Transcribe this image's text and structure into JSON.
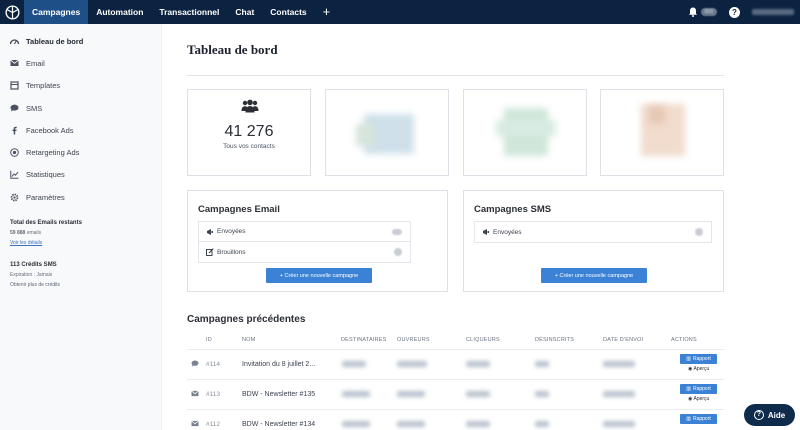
{
  "topbar": {
    "nav": [
      {
        "label": "Campagnes",
        "active": true
      },
      {
        "label": "Automation"
      },
      {
        "label": "Transactionnel"
      },
      {
        "label": "Chat"
      },
      {
        "label": "Contacts"
      }
    ],
    "plus": "+",
    "help": "?"
  },
  "sidebar": {
    "items": [
      {
        "label": "Tableau de bord",
        "icon": "dashboard-icon",
        "active": true
      },
      {
        "label": "Email",
        "icon": "envelope-icon"
      },
      {
        "label": "Templates",
        "icon": "template-icon"
      },
      {
        "label": "SMS",
        "icon": "sms-icon"
      },
      {
        "label": "Facebook Ads",
        "icon": "facebook-icon"
      },
      {
        "label": "Retargeting Ads",
        "icon": "target-icon"
      },
      {
        "label": "Statistiques",
        "icon": "chart-icon"
      },
      {
        "label": "Paramètres",
        "icon": "gear-icon"
      }
    ],
    "emails": {
      "title": "Total des Emails restants",
      "value": "59 888",
      "unit": "emails",
      "link": "Voir les détails"
    },
    "sms": {
      "title": "113 Crédits SMS",
      "expiration": "Expiration : Jamais",
      "link": "Obtenir plus de crédits"
    }
  },
  "main": {
    "title": "Tableau de bord",
    "contacts": {
      "value": "41 276",
      "label": "Tous vos contacts"
    },
    "email_campaigns": {
      "title": "Campagnes Email",
      "rows": [
        "Envoyées",
        "Brouillons"
      ],
      "button": "+ Créer une nouvelle campagne"
    },
    "sms_campaigns": {
      "title": "Campagnes SMS",
      "rows": [
        "Envoyées"
      ],
      "button": "+ Créer une nouvelle campagne"
    },
    "previous": {
      "title": "Campagnes précédentes",
      "columns": [
        "ID",
        "NOM",
        "DESTINATAIRES",
        "OUVREURS",
        "CLIQUEURS",
        "DÉSINSCRITS",
        "DATE D'ENVOI",
        "ACTIONS"
      ],
      "rows": [
        {
          "icon": "sms-icon",
          "id": "#114",
          "name": "Invitation du 8 juillet 2..."
        },
        {
          "icon": "envelope-icon",
          "id": "#113",
          "name": "BDW - Newsletter #135"
        },
        {
          "icon": "envelope-icon",
          "id": "#112",
          "name": "BDW - Newsletter #134"
        }
      ],
      "report_label": "Rapport",
      "preview_label": "Aperçu"
    }
  },
  "help_button": "Aide",
  "colors": {
    "topbar": "#0b2340",
    "active_tab": "#1e4f86",
    "primary": "#3b82d6"
  }
}
